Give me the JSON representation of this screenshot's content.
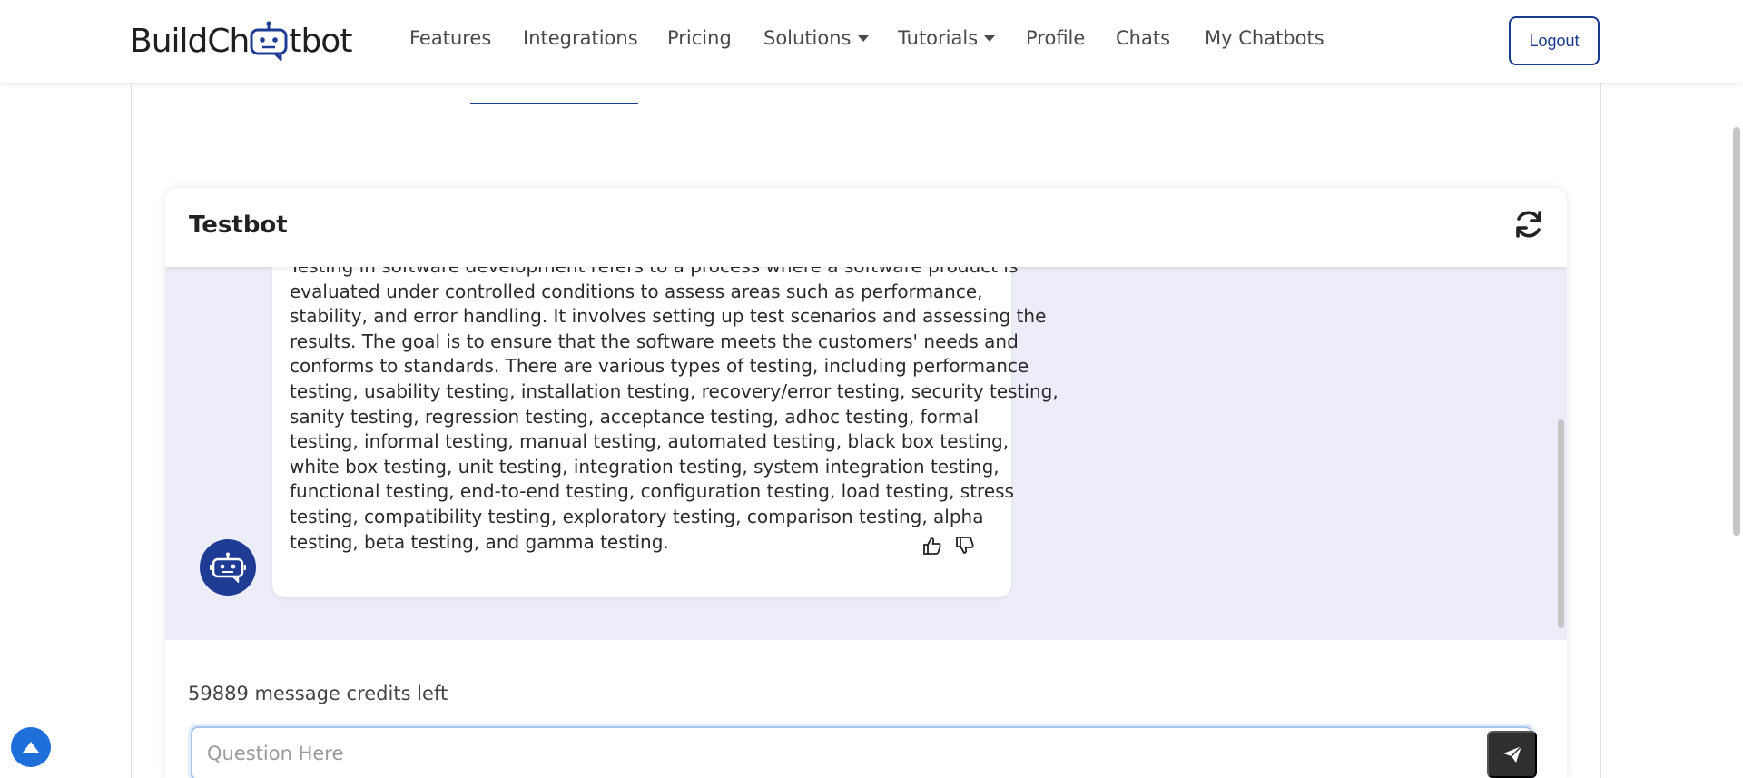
{
  "navbar": {
    "logo_text_left": "BuildCh",
    "logo_text_right": "tbot",
    "items": [
      {
        "label": "Features",
        "has_caret": false
      },
      {
        "label": "Integrations",
        "has_caret": false
      },
      {
        "label": "Pricing",
        "has_caret": false
      },
      {
        "label": "Solutions",
        "has_caret": true
      },
      {
        "label": "Tutorials",
        "has_caret": true
      },
      {
        "label": "Profile",
        "has_caret": false
      },
      {
        "label": "Chats",
        "has_caret": false
      },
      {
        "label": "My Chatbots",
        "has_caret": false
      }
    ],
    "logout_label": "Logout"
  },
  "chat": {
    "title": "Testbot",
    "refresh_icon": "refresh-icon",
    "bot_message_lines": [
      "Testing in software development refers to a process where a software product is",
      "evaluated under controlled conditions to assess areas such as performance,",
      "stability, and error handling. It involves setting up test scenarios and assessing the",
      "results. The goal is to ensure that the software meets the customers' needs and",
      "conforms to standards. There are various types of testing, including performance",
      "testing, usability testing, installation testing, recovery/error testing, security testing,",
      "sanity testing, regression testing, acceptance testing, adhoc testing, formal",
      "testing, informal testing, manual testing, automated testing, black box testing,",
      "white box testing, unit testing, integration testing, system integration testing,",
      "functional testing, end-to-end testing, configuration testing, load testing, stress",
      "testing, compatibility testing, exploratory testing, comparison testing, alpha",
      "testing, beta testing, and gamma testing."
    ],
    "credits_text": "59889 message credits left",
    "input_placeholder": "Question Here",
    "input_value": ""
  },
  "colors": {
    "brand_blue": "#1a3a8f",
    "avatar_blue": "#1e3c94",
    "messages_bg": "#ecedf8",
    "send_button": "#2f2f2f",
    "back_to_top": "#1e6fd9"
  },
  "icons": [
    "robot-logo-icon",
    "refresh-icon",
    "bot-avatar-icon",
    "thumbs-up-icon",
    "thumbs-down-icon",
    "send-icon",
    "arrow-up-icon"
  ]
}
